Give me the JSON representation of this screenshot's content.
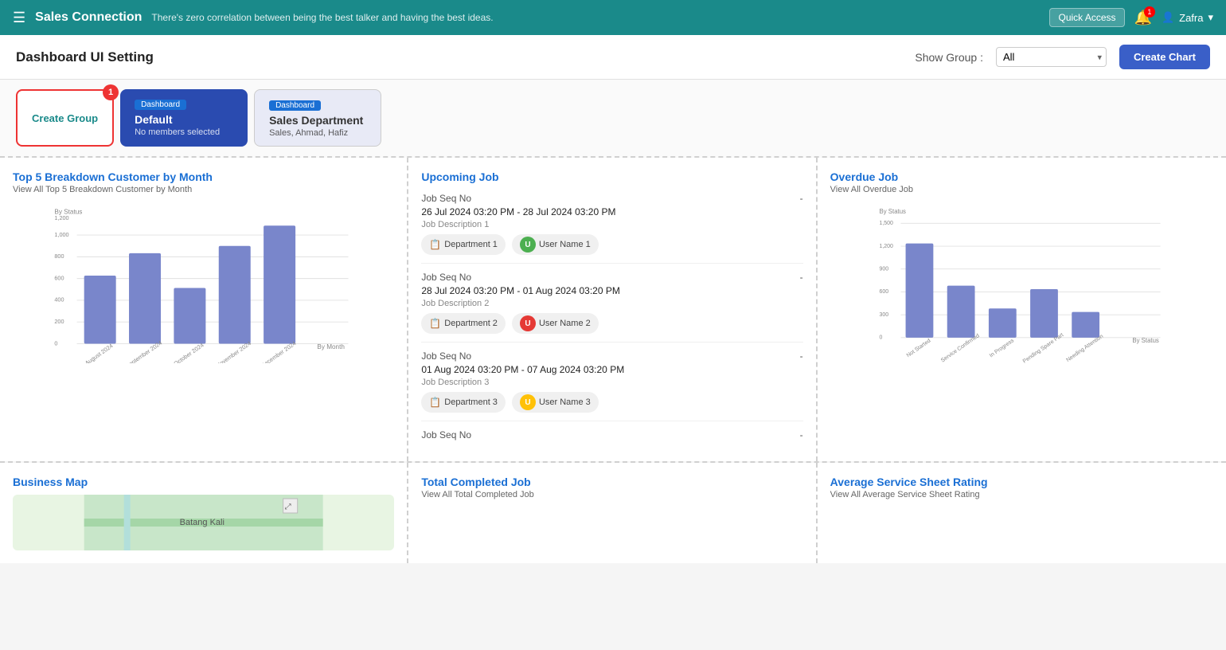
{
  "header": {
    "menu_icon": "☰",
    "title": "Sales Connection",
    "tagline": "There's zero correlation between being the best talker and having the best ideas.",
    "quick_access": "Quick Access",
    "notification_icon": "🔔",
    "user_icon": "👤",
    "user_name": "Zafra",
    "chevron_icon": "▾"
  },
  "toolbar": {
    "title": "Dashboard UI Setting",
    "show_group_label": "Show Group :",
    "show_group_value": "All",
    "show_group_options": [
      "All",
      "Default",
      "Sales Department"
    ],
    "create_chart_label": "Create Chart"
  },
  "groups": {
    "create_group_label": "Create Group",
    "create_group_badge": "1",
    "cards": [
      {
        "tag": "Dashboard",
        "name": "Default",
        "sub": "No members selected",
        "active": true
      },
      {
        "tag": "Dashboard",
        "name": "Sales Department",
        "sub": "Sales, Ahmad, Hafiz",
        "active": false
      }
    ]
  },
  "top5_chart": {
    "title": "Top 5 Breakdown Customer by Month",
    "subtitle": "View All Top 5 Breakdown Customer by Month",
    "y_label": "By Status",
    "x_label": "By Month",
    "y_max": 1200,
    "bars": [
      {
        "label": "August 2024",
        "value": 660
      },
      {
        "label": "September 2024",
        "value": 880
      },
      {
        "label": "October 2024",
        "value": 540
      },
      {
        "label": "November 2024",
        "value": 950
      },
      {
        "label": "December 2024",
        "value": 1150
      }
    ],
    "y_ticks": [
      0,
      200,
      400,
      600,
      800,
      1000,
      1200
    ],
    "bar_color": "#7986cb"
  },
  "upcoming_job": {
    "title": "Upcoming Job",
    "jobs": [
      {
        "seq": "Job Seq No",
        "date": "26 Jul 2024 03:20 PM - 28 Jul 2024 03:20 PM",
        "desc": "Job Description 1",
        "dept": "Department 1",
        "user_avatar_color": "#4CAF50",
        "user_initial": "U",
        "user_name": "User Name 1"
      },
      {
        "seq": "Job Seq No",
        "date": "28 Jul 2024 03:20 PM - 01 Aug 2024 03:20 PM",
        "desc": "Job Description 2",
        "dept": "Department 2",
        "user_avatar_color": "#e53935",
        "user_initial": "U",
        "user_name": "User Name 2"
      },
      {
        "seq": "Job Seq No",
        "date": "01 Aug 2024 03:20 PM - 07 Aug 2024 03:20 PM",
        "desc": "Job Description 3",
        "dept": "Department 3",
        "user_avatar_color": "#FFC107",
        "user_initial": "U",
        "user_name": "User Name 3"
      },
      {
        "seq": "Job Seq No",
        "date": "",
        "desc": "",
        "dept": "",
        "user_avatar_color": "",
        "user_initial": "",
        "user_name": ""
      }
    ]
  },
  "overdue_job": {
    "title": "Overdue Job",
    "subtitle": "View All Overdue Job",
    "y_label": "By Status",
    "x_label": "By Status",
    "y_max": 1500,
    "bars": [
      {
        "label": "Not Started",
        "value": 1230
      },
      {
        "label": "Service Confirmed",
        "value": 680
      },
      {
        "label": "In Progress",
        "value": 380
      },
      {
        "label": "Pending Spare Part",
        "value": 640
      },
      {
        "label": "Needing Attention",
        "value": 340
      }
    ],
    "y_ticks": [
      0,
      300,
      600,
      900,
      1200,
      1500
    ],
    "bar_color": "#7986cb"
  },
  "business_map": {
    "title": "Business Map",
    "map_location": "Batang Kali"
  },
  "total_completed": {
    "title": "Total Completed Job",
    "subtitle": "View All Total Completed Job"
  },
  "avg_rating": {
    "title": "Average Service Sheet Rating",
    "subtitle": "View All Average Service Sheet Rating"
  }
}
